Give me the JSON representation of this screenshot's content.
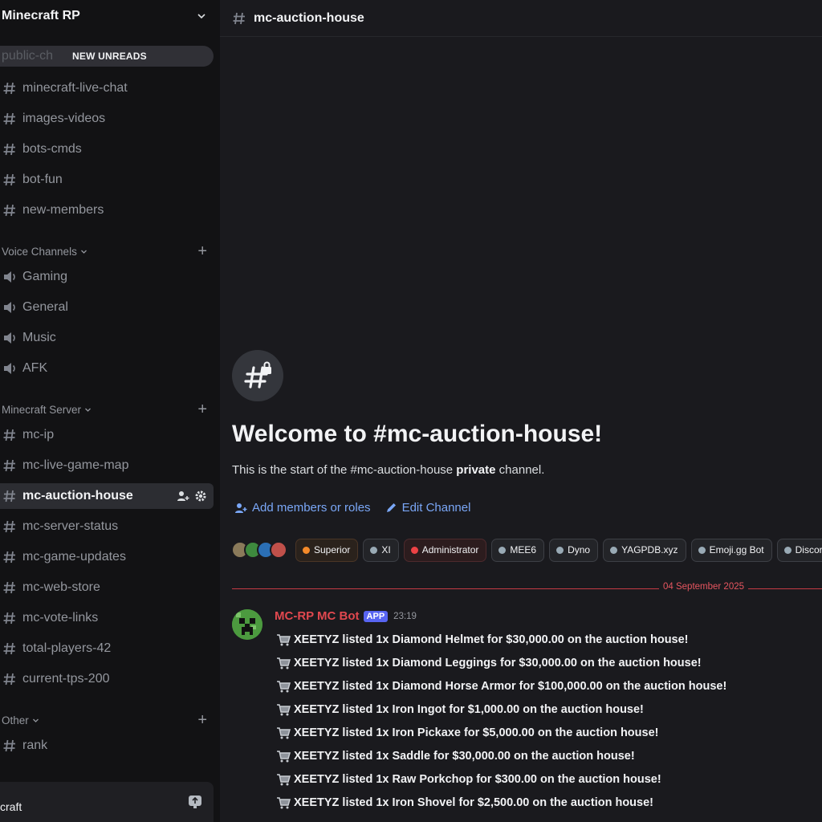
{
  "server": {
    "name": "Minecraft RP"
  },
  "sidebar": {
    "new_unreads": "NEW UNREADS",
    "ghost_channel": "public-ch",
    "text_channels": [
      "minecraft-live-chat",
      "images-videos",
      "bots-cmds",
      "bot-fun",
      "new-members"
    ],
    "voice_category": "Voice Channels",
    "voice_channels": [
      "Gaming",
      "General",
      "Music",
      "AFK"
    ],
    "mc_category": "Minecraft Server",
    "mc_channels": [
      "mc-ip",
      "mc-live-game-map",
      "mc-auction-house",
      "mc-server-status",
      "mc-game-updates",
      "mc-web-store",
      "mc-vote-links",
      "total-players-42",
      "current-tps-200"
    ],
    "other_category": "Other",
    "other_channels": [
      "rank"
    ],
    "user_panel_name": "craft"
  },
  "main": {
    "channel_title": "mc-auction-house",
    "welcome_title": "Welcome to #mc-auction-house!",
    "welcome_sub_pre": "This is the start of the #mc-auction-house ",
    "welcome_sub_bold": "private",
    "welcome_sub_post": " channel.",
    "add_members": "Add members or roles",
    "edit_channel": "Edit Channel",
    "roles": [
      {
        "name": "Superior",
        "color": "#f48a2a"
      },
      {
        "name": "XI",
        "color": "#99aab5"
      },
      {
        "name": "Administrator",
        "color": "#ed4245"
      },
      {
        "name": "MEE6",
        "color": "#99aab5"
      },
      {
        "name": "Dyno",
        "color": "#99aab5"
      },
      {
        "name": "YAGPDB.xyz",
        "color": "#99aab5"
      },
      {
        "name": "Emoji.gg Bot",
        "color": "#99aab5"
      },
      {
        "name": "Discord Me",
        "color": "#99aab5"
      }
    ],
    "date_divider": "04 September 2025",
    "message": {
      "author": "MC-RP MC Bot",
      "tag": "APP",
      "time": "23:19",
      "lines": [
        "XEETYZ listed 1x Diamond Helmet for $30,000.00 on the auction house!",
        "XEETYZ listed 1x Diamond Leggings for $30,000.00 on the auction house!",
        "XEETYZ listed 1x Diamond Horse Armor for $100,000.00 on the auction house!",
        "XEETYZ listed 1x Iron Ingot for $1,000.00 on the auction house!",
        "XEETYZ listed 1x Iron Pickaxe for $5,000.00 on the auction house!",
        "XEETYZ listed 1x Saddle for $30,000.00 on the auction house!",
        "XEETYZ listed 1x Raw Porkchop for $300.00 on the auction house!",
        "XEETYZ listed 1x Iron Shovel for $2,500.00 on the auction house!"
      ]
    }
  },
  "colors": {
    "accent_link": "#7aa7f7",
    "author": "#e1484f",
    "divider": "#c43a45",
    "app_tag": "#5865f2"
  }
}
